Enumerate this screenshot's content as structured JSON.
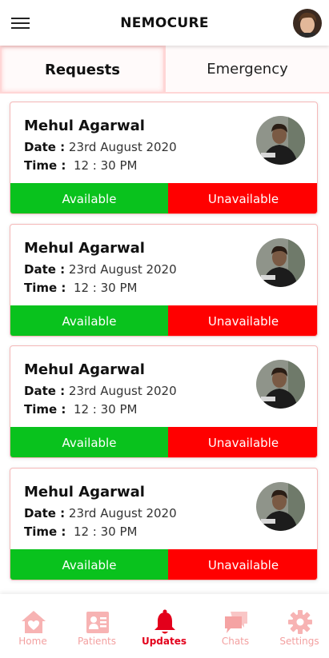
{
  "app": {
    "title": "NEMOCURE"
  },
  "tabs": [
    {
      "label": "Requests",
      "active": true
    },
    {
      "label": "Emergency",
      "active": false
    }
  ],
  "requests": [
    {
      "name": "Mehul Agarwal",
      "date_label": "Date :",
      "date": "23rd August 2020",
      "time_label": "Time :",
      "time": "12 : 30 PM",
      "available_label": "Available",
      "unavailable_label": "Unavailable"
    },
    {
      "name": "Mehul Agarwal",
      "date_label": "Date :",
      "date": "23rd August 2020",
      "time_label": "Time :",
      "time": "12 : 30 PM",
      "available_label": "Available",
      "unavailable_label": "Unavailable"
    },
    {
      "name": "Mehul Agarwal",
      "date_label": "Date :",
      "date": "23rd August 2020",
      "time_label": "Time :",
      "time": "12 : 30 PM",
      "available_label": "Available",
      "unavailable_label": "Unavailable"
    },
    {
      "name": "Mehul Agarwal",
      "date_label": "Date :",
      "date": "23rd August 2020",
      "time_label": "Time :",
      "time": "12 : 30 PM",
      "available_label": "Available",
      "unavailable_label": "Unavailable"
    }
  ],
  "nav": [
    {
      "label": "Home",
      "icon": "home-icon",
      "active": false
    },
    {
      "label": "Patients",
      "icon": "patients-icon",
      "active": false
    },
    {
      "label": "Updates",
      "icon": "bell-icon",
      "active": true
    },
    {
      "label": "Chats",
      "icon": "chat-icon",
      "active": false
    },
    {
      "label": "Settings",
      "icon": "gear-icon",
      "active": false
    }
  ],
  "colors": {
    "available": "#09c21d",
    "unavailable": "#ff0000",
    "accent": "#e3001b",
    "inactive_nav": "#f3a0a0"
  }
}
